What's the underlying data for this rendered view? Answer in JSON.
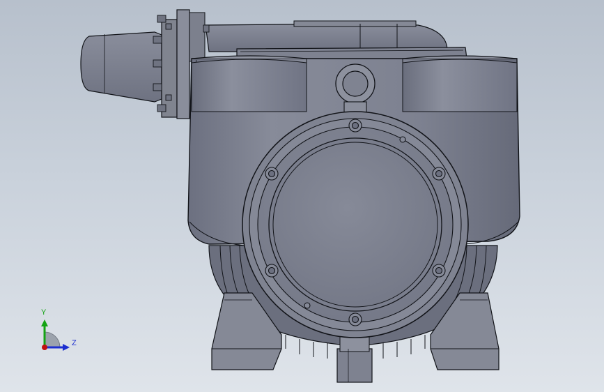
{
  "viewport": {
    "background_top": "#b7c0cc",
    "background_bottom": "#dfe4ea",
    "model_fill": "#7b7f8e",
    "model_shade": "#6a6e7d",
    "model_highlight": "#a7abb8",
    "edge_color": "#111318"
  },
  "triad": {
    "y_label": "Y",
    "z_label": "Z",
    "y_color": "#13a313",
    "z_color": "#1d2fd0",
    "x_color": "#c01010",
    "label_y_color": "#13a313",
    "label_z_color": "#1d2fd0"
  }
}
